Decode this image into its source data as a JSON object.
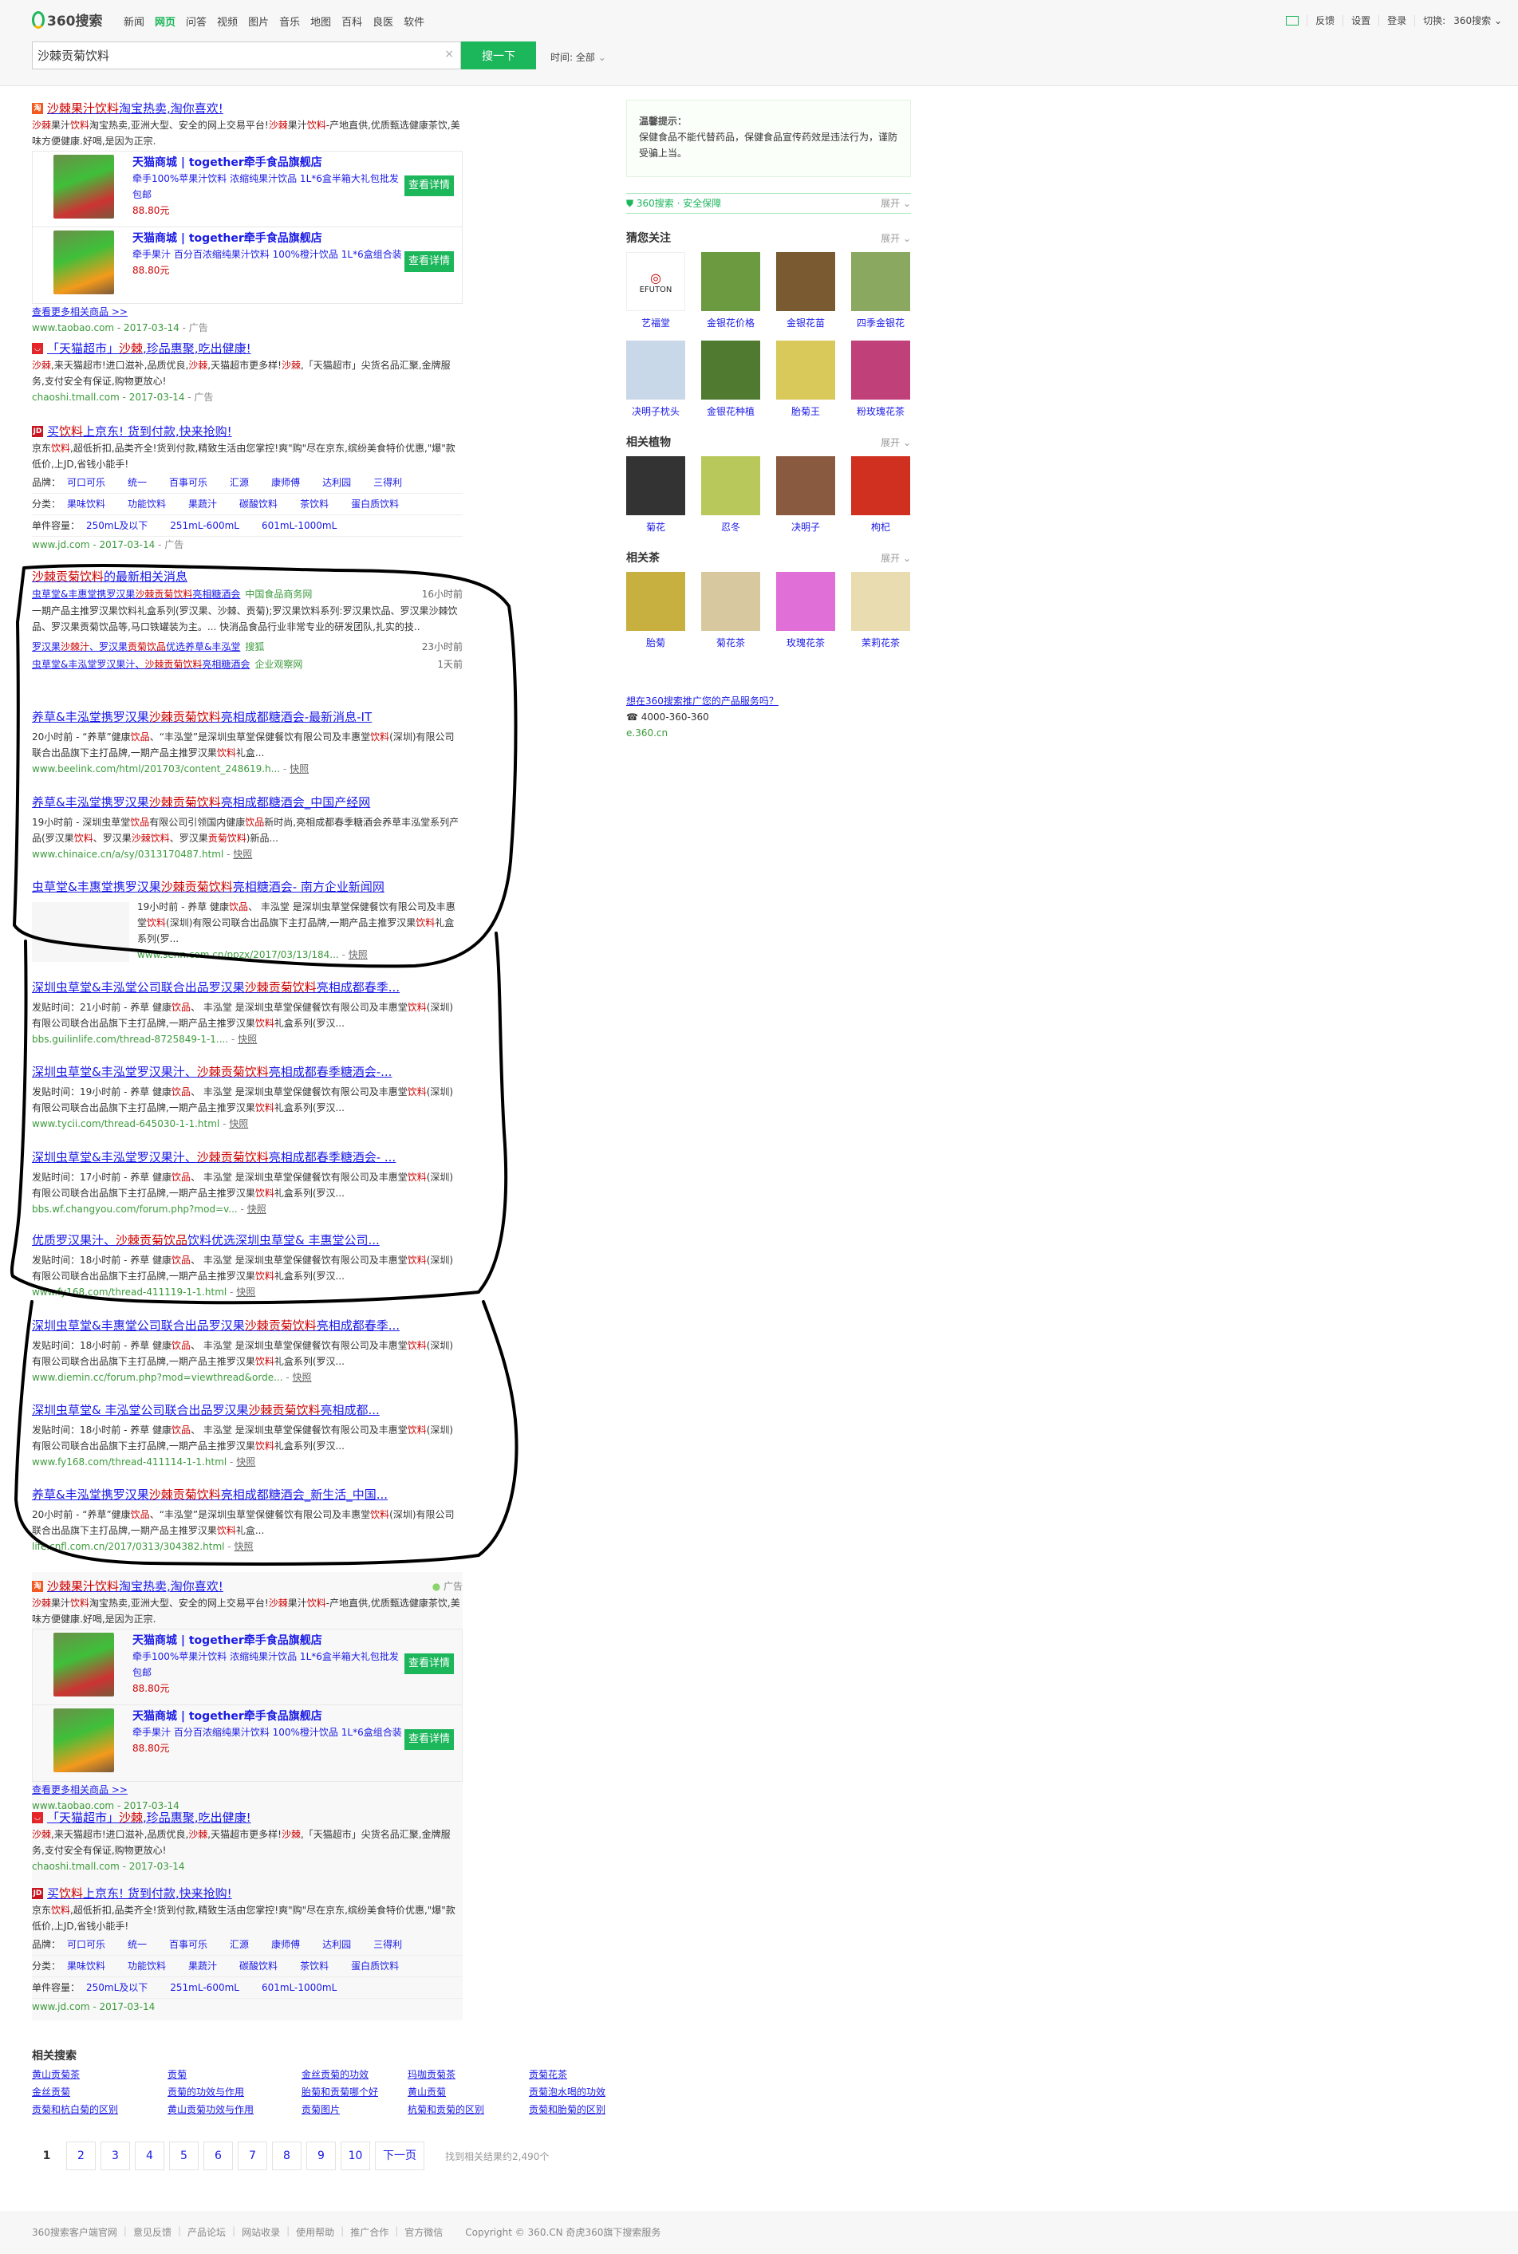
{
  "header": {
    "logo": "360搜索",
    "nav": [
      "新闻",
      "网页",
      "问答",
      "视频",
      "图片",
      "音乐",
      "地图",
      "百科",
      "良医",
      "软件"
    ],
    "nav_active": 1,
    "right_links": [
      "反馈",
      "设置",
      "登录"
    ],
    "switch_label": "切换:",
    "switch_value": "360搜索",
    "search_value": "沙棘贡菊饮料",
    "clear": "×",
    "search_button": "搜一下",
    "time_filter": "时间: 全部"
  },
  "colors": {
    "brand": "#1cb65b",
    "link": "#1a1ae6",
    "highlight": "#cc0000",
    "url": "#3c9a3c"
  },
  "ads_top": {
    "taobao": {
      "title": [
        [
          "沙棘果汁饮料",
          1
        ],
        [
          "淘宝热卖,淘你喜欢!",
          0
        ]
      ],
      "desc": [
        [
          "沙棘",
          1
        ],
        [
          "果汁",
          0
        ],
        [
          "饮料",
          1
        ],
        [
          "淘宝热卖,亚洲大型、安全的网上交易平台!",
          0
        ],
        [
          "沙棘",
          1
        ],
        [
          "果汁",
          0
        ],
        [
          "饮料",
          1
        ],
        [
          "-产地直供,优质甄选健康茶饮,美味方便健康.好喝,是因为正宗.",
          0
        ]
      ],
      "products": [
        {
          "name": "天猫商城 | together牵手食品旗舰店",
          "desc": "牵手100%苹果汁饮料 浓缩纯果汁饮品 1L*6盒半箱大礼包批发包邮",
          "price": "88.80元",
          "button": "查看详情"
        },
        {
          "name": "天猫商城 | together牵手食品旗舰店",
          "desc": "牵手果汁 百分百浓缩纯果汁饮料 100%橙汁饮品 1L*6盒组合装",
          "price": "88.80元",
          "button": "查看详情"
        }
      ],
      "more": "查看更多相关商品 >>",
      "url": "www.taobao.com - 2017-03-14",
      "ad_label": " - 广告"
    },
    "tmall": {
      "title": [
        [
          "「天猫超市」",
          0
        ],
        [
          "沙棘",
          1
        ],
        [
          ",珍品惠聚,吃出健康!",
          0
        ]
      ],
      "desc": [
        [
          "沙棘",
          1
        ],
        [
          ",来天猫超市!进口滋补,品质优良,",
          0
        ],
        [
          "沙棘",
          1
        ],
        [
          ",天猫超市更多样!",
          0
        ],
        [
          "沙棘",
          1
        ],
        [
          ",「天猫超市」尖货名品汇聚,金牌服务,支付安全有保证,购物更放心!",
          0
        ]
      ],
      "url": "chaoshi.tmall.com - 2017-03-14",
      "ad_label": " - 广告"
    },
    "jd": {
      "title": [
        [
          "买",
          0
        ],
        [
          "饮料",
          1
        ],
        [
          "上京东! 货到付款,快来抢购!",
          0
        ]
      ],
      "desc": [
        [
          "京东",
          0
        ],
        [
          "饮料",
          1
        ],
        [
          ",超低折扣,品类齐全!货到付款,精致生活由您掌控!爽\"购\"尽在京东,缤纷美食特价优惠,\"爆\"款低价,上JD,省钱小能手!",
          0
        ]
      ],
      "brand_label": "品牌：",
      "brands": [
        "可口可乐",
        "统一",
        "百事可乐",
        "汇源",
        "康师傅",
        "达利园",
        "三得利"
      ],
      "category_label": "分类：",
      "categories": [
        "果味饮料",
        "功能饮料",
        "果蔬汁",
        "碳酸饮料",
        "茶饮料",
        "蛋白质饮料"
      ],
      "volume_label": "单件容量：",
      "volumes": [
        "250mL及以下",
        "251mL-600mL",
        "601mL-1000mL"
      ],
      "url": "www.jd.com - 2017-03-14",
      "ad_label": " - 广告"
    }
  },
  "news": {
    "header": [
      [
        "沙棘贡菊饮料",
        1
      ],
      [
        "的最新相关消息",
        0
      ]
    ],
    "items": [
      {
        "title": [
          [
            "虫草堂&丰惠堂携罗汉果",
            0
          ],
          [
            "沙棘贡菊饮料",
            1
          ],
          [
            "亮相糖酒会",
            0
          ]
        ],
        "source": "中国食品商务网",
        "time": "16小时前",
        "snippet": "一期产品主推罗汉果饮料礼盒系列(罗汉果、沙棘、贡菊);罗汉果饮料系列:罗汉果饮品、罗汉果沙棘饮品、罗汉果贡菊饮品等,马口铁罐装为主。... 快消品食品行业非常专业的研发团队,扎实的技.."
      },
      {
        "title": [
          [
            "罗汉果",
            0
          ],
          [
            "沙棘汁",
            1
          ],
          [
            "、罗汉果",
            0
          ],
          [
            "贡菊饮品",
            1
          ],
          [
            "优选养草&丰泓堂",
            0
          ]
        ],
        "source": "搜狐",
        "time": "23小时前"
      },
      {
        "title": [
          [
            "虫草堂&丰泓堂罗汉果汁、",
            0
          ],
          [
            "沙棘贡菊饮料",
            1
          ],
          [
            "亮相糖酒会",
            0
          ]
        ],
        "source": "企业观察网",
        "time": "1天前"
      }
    ]
  },
  "results": [
    {
      "title": [
        [
          "养草&丰泓堂携罗汉果",
          0
        ],
        [
          "沙棘贡菊饮料",
          1
        ],
        [
          "亮相成都糖酒会-最新消息-IT",
          0
        ]
      ],
      "snippet": [
        [
          "20小时前 - “养草”健康",
          0
        ],
        [
          "饮品",
          1
        ],
        [
          "、“丰泓堂”是深圳虫草堂保健餐饮有限公司及丰惠堂",
          0
        ],
        [
          "饮料",
          1
        ],
        [
          "(深圳)有限公司联合出品旗下主打品牌,一期产品主推罗汉果",
          0
        ],
        [
          "饮料",
          1
        ],
        [
          "礼盒...",
          0
        ]
      ],
      "url": "www.beelink.com/html/201703/content_248619.h...",
      "snapshot": "快照"
    },
    {
      "title": [
        [
          "养草&丰泓堂携罗汉果",
          0
        ],
        [
          "沙棘贡菊饮料",
          1
        ],
        [
          "亮相成都糖酒会_中国产经网",
          0
        ]
      ],
      "snippet": [
        [
          "19小时前 - 深圳虫草堂",
          0
        ],
        [
          "饮品",
          1
        ],
        [
          "有限公司引领国内健康",
          0
        ],
        [
          "饮品",
          1
        ],
        [
          "新时尚,亮相成都春季糖酒会养草丰泓堂系列产品(罗汉果",
          0
        ],
        [
          "饮料",
          1
        ],
        [
          "、罗汉果",
          0
        ],
        [
          "沙棘饮料",
          1
        ],
        [
          "、罗汉果",
          0
        ],
        [
          "贡菊饮料",
          1
        ],
        [
          ")新品...",
          0
        ]
      ],
      "url": "www.chinaice.cn/a/sy/0313170487.html",
      "snapshot": "快照"
    },
    {
      "title": [
        [
          "虫草堂&丰惠堂携罗汉果",
          0
        ],
        [
          "沙棘贡菊饮料",
          1
        ],
        [
          "亮相糖酒会- 南方企业新闻网",
          0
        ]
      ],
      "has_thumb": true,
      "snippet": [
        [
          "19小时前 - 养草 健康",
          0
        ],
        [
          "饮品",
          1
        ],
        [
          "、 丰泓堂 是深圳虫草堂保健餐饮有限公司及丰惠堂",
          0
        ],
        [
          "饮料",
          1
        ],
        [
          "(深圳)有限公司联合出品旗下主打品牌,一期产品主推罗汉果",
          0
        ],
        [
          "饮料",
          1
        ],
        [
          "礼盒系列(罗...",
          0
        ]
      ],
      "url": "www.senn.com.cn/ppzx/2017/03/13/184...",
      "snapshot": "快照"
    },
    {
      "title": [
        [
          "深圳虫草堂&丰泓堂公司联合出品罗汉果",
          0
        ],
        [
          "沙棘贡菊饮料",
          1
        ],
        [
          "亮相成都春季...",
          0
        ]
      ],
      "snippet": [
        [
          "发贴时间：21小时前 - 养草 健康",
          0
        ],
        [
          "饮品",
          1
        ],
        [
          "、 丰泓堂 是深圳虫草堂保健餐饮有限公司及丰惠堂",
          0
        ],
        [
          "饮料",
          1
        ],
        [
          "(深圳)有限公司联合出品旗下主打品牌,一期产品主推罗汉果",
          0
        ],
        [
          "饮料",
          1
        ],
        [
          "礼盒系列(罗汉...",
          0
        ]
      ],
      "url": "bbs.guilinlife.com/thread-8725849-1-1....",
      "snapshot": "快照"
    },
    {
      "title": [
        [
          "深圳虫草堂&丰泓堂罗汉果汁、",
          0
        ],
        [
          "沙棘贡菊饮料",
          1
        ],
        [
          "亮相成都春季糖酒会-...",
          0
        ]
      ],
      "snippet": [
        [
          "发贴时间：19小时前 - 养草 健康",
          0
        ],
        [
          "饮品",
          1
        ],
        [
          "、 丰泓堂 是深圳虫草堂保健餐饮有限公司及丰惠堂",
          0
        ],
        [
          "饮料",
          1
        ],
        [
          "(深圳)有限公司联合出品旗下主打品牌,一期产品主推罗汉果",
          0
        ],
        [
          "饮料",
          1
        ],
        [
          "礼盒系列(罗汉...",
          0
        ]
      ],
      "url": "www.tycii.com/thread-645030-1-1.html",
      "snapshot": "快照"
    },
    {
      "title": [
        [
          "深圳虫草堂&丰泓堂罗汉果汁、",
          0
        ],
        [
          "沙棘贡菊饮料",
          1
        ],
        [
          "亮相成都春季糖酒会- ...",
          0
        ]
      ],
      "snippet": [
        [
          "发贴时间：17小时前 - 养草 健康",
          0
        ],
        [
          "饮品",
          1
        ],
        [
          "、 丰泓堂 是深圳虫草堂保健餐饮有限公司及丰惠堂",
          0
        ],
        [
          "饮料",
          1
        ],
        [
          "(深圳)有限公司联合出品旗下主打品牌,一期产品主推罗汉果",
          0
        ],
        [
          "饮料",
          1
        ],
        [
          "礼盒系列(罗汉...",
          0
        ]
      ],
      "url": "bbs.wf.changyou.com/forum.php?mod=v...",
      "snapshot": "快照"
    },
    {
      "title": [
        [
          "优质罗汉果汁、",
          0
        ],
        [
          "沙棘贡菊饮品",
          1
        ],
        [
          "饮料优选深圳虫草堂& 丰惠堂公司...",
          0
        ]
      ],
      "snippet": [
        [
          "发贴时间：18小时前 - 养草 健康",
          0
        ],
        [
          "饮品",
          1
        ],
        [
          "、 丰泓堂 是深圳虫草堂保健餐饮有限公司及丰惠堂",
          0
        ],
        [
          "饮料",
          1
        ],
        [
          "(深圳)有限公司联合出品旗下主打品牌,一期产品主推罗汉果",
          0
        ],
        [
          "饮料",
          1
        ],
        [
          "礼盒系列(罗汉...",
          0
        ]
      ],
      "url": "www.fy168.com/thread-411119-1-1.html",
      "snapshot": "快照"
    },
    {
      "title": [
        [
          "深圳虫草堂&丰惠堂公司联合出品罗汉果",
          0
        ],
        [
          "沙棘贡菊饮料",
          1
        ],
        [
          "亮相成都春季...",
          0
        ]
      ],
      "snippet": [
        [
          "发贴时间：18小时前 - 养草 健康",
          0
        ],
        [
          "饮品",
          1
        ],
        [
          "、 丰泓堂 是深圳虫草堂保健餐饮有限公司及丰惠堂",
          0
        ],
        [
          "饮料",
          1
        ],
        [
          "(深圳)有限公司联合出品旗下主打品牌,一期产品主推罗汉果",
          0
        ],
        [
          "饮料",
          1
        ],
        [
          "礼盒系列(罗汉...",
          0
        ]
      ],
      "url": "www.diemin.cc/forum.php?mod=viewthread&orde...",
      "snapshot": "快照"
    },
    {
      "title": [
        [
          "深圳虫草堂& 丰泓堂公司联合出品罗汉果",
          0
        ],
        [
          "沙棘贡菊饮料",
          1
        ],
        [
          "亮相成都...",
          0
        ]
      ],
      "snippet": [
        [
          "发贴时间：18小时前 - 养草 健康",
          0
        ],
        [
          "饮品",
          1
        ],
        [
          "、 丰泓堂 是深圳虫草堂保健餐饮有限公司及丰惠堂",
          0
        ],
        [
          "饮料",
          1
        ],
        [
          "(深圳)有限公司联合出品旗下主打品牌,一期产品主推罗汉果",
          0
        ],
        [
          "饮料",
          1
        ],
        [
          "礼盒系列(罗汉...",
          0
        ]
      ],
      "url": "www.fy168.com/thread-411114-1-1.html",
      "snapshot": "快照"
    },
    {
      "title": [
        [
          "养草&丰泓堂携罗汉果",
          0
        ],
        [
          "沙棘贡菊饮料",
          1
        ],
        [
          "亮相成都糖酒会_新生活_中国...",
          0
        ]
      ],
      "snippet": [
        [
          "20小时前 - “养草”健康",
          0
        ],
        [
          "饮品",
          1
        ],
        [
          "、“丰泓堂”是深圳虫草堂保健餐饮有限公司及丰惠堂",
          0
        ],
        [
          "饮料",
          1
        ],
        [
          "(深圳)有限公司联合出品旗下主打品牌,一期产品主推罗汉果",
          0
        ],
        [
          "饮料",
          1
        ],
        [
          "礼盒...",
          0
        ]
      ],
      "url": "life.cnfl.com.cn/2017/0313/304382.html",
      "snapshot": "快照"
    }
  ],
  "ads_bottom": {
    "ad_tag": "广告",
    "taobao": {
      "title": [
        [
          "沙棘果汁饮料",
          1
        ],
        [
          "淘宝热卖,淘你喜欢!",
          0
        ]
      ],
      "desc": [
        [
          "沙棘",
          1
        ],
        [
          "果汁",
          0
        ],
        [
          "饮料",
          1
        ],
        [
          "淘宝热卖,亚洲大型、安全的网上交易平台!",
          0
        ],
        [
          "沙棘",
          1
        ],
        [
          "果汁",
          0
        ],
        [
          "饮料",
          1
        ],
        [
          "-产地直供,优质甄选健康茶饮,美味方便健康.好喝,是因为正宗.",
          0
        ]
      ],
      "products": [
        {
          "name": "天猫商城 | together牵手食品旗舰店",
          "desc": "牵手100%苹果汁饮料 浓缩纯果汁饮品 1L*6盒半箱大礼包批发包邮",
          "price": "88.80元",
          "button": "查看详情"
        },
        {
          "name": "天猫商城 | together牵手食品旗舰店",
          "desc": "牵手果汁 百分百浓缩纯果汁饮料 100%橙汁饮品 1L*6盒组合装",
          "price": "88.80元",
          "button": "查看详情"
        }
      ],
      "more": "查看更多相关商品 >>",
      "url": "www.taobao.com - 2017-03-14"
    },
    "tmall": {
      "title": [
        [
          "「天猫超市」",
          0
        ],
        [
          "沙棘",
          1
        ],
        [
          ",珍品惠聚,吃出健康!",
          0
        ]
      ],
      "desc": [
        [
          "沙棘",
          1
        ],
        [
          ",来天猫超市!进口滋补,品质优良,",
          0
        ],
        [
          "沙棘",
          1
        ],
        [
          ",天猫超市更多样!",
          0
        ],
        [
          "沙棘",
          1
        ],
        [
          ",「天猫超市」尖货名品汇聚,金牌服务,支付安全有保证,购物更放心!",
          0
        ]
      ],
      "url": "chaoshi.tmall.com - 2017-03-14"
    },
    "jd": {
      "title": [
        [
          "买",
          0
        ],
        [
          "饮料",
          1
        ],
        [
          "上京东! 货到付款,快来抢购!",
          0
        ]
      ],
      "desc": [
        [
          "京东",
          0
        ],
        [
          "饮料",
          1
        ],
        [
          ",超低折扣,品类齐全!货到付款,精致生活由您掌控!爽\"购\"尽在京东,缤纷美食特价优惠,\"爆\"款低价,上JD,省钱小能手!",
          0
        ]
      ],
      "brand_label": "品牌：",
      "brands": [
        "可口可乐",
        "统一",
        "百事可乐",
        "汇源",
        "康师傅",
        "达利园",
        "三得利"
      ],
      "category_label": "分类：",
      "categories": [
        "果味饮料",
        "功能饮料",
        "果蔬汁",
        "碳酸饮料",
        "茶饮料",
        "蛋白质饮料"
      ],
      "volume_label": "单件容量：",
      "volumes": [
        "250mL及以下",
        "251mL-600mL",
        "601mL-1000mL"
      ],
      "url": "www.jd.com - 2017-03-14"
    }
  },
  "sidebar": {
    "tip_title": "温馨提示：",
    "tip_text": "保健食品不能代替药品，保健食品宣传药效是违法行为，谨防受骗上当。",
    "safe_label": "360搜索 · 安全保障",
    "expand": "展开",
    "sections": [
      {
        "title": "猜您关注",
        "items": [
          "艺福堂",
          "金银花价格",
          "金银花苗",
          "四季金银花",
          "决明子枕头",
          "金银花种植",
          "胎菊王",
          "粉玫瑰花茶"
        ]
      },
      {
        "title": "相关植物",
        "items": [
          "菊花",
          "忍冬",
          "决明子",
          "枸杞"
        ]
      },
      {
        "title": "相关茶",
        "items": [
          "胎菊",
          "菊花茶",
          "玫瑰花茶",
          "茉莉花茶"
        ]
      }
    ],
    "logo_text": "艺福堂 EFUTON",
    "promo_link": "想在360搜索推广您的产品服务吗？",
    "phone": "4000-360-360",
    "promo_url": "e.360.cn"
  },
  "related": {
    "title": "相关搜索",
    "items": [
      "黄山贡菊茶",
      "贡菊",
      "金丝贡菊的功效",
      "玛咖贡菊茶",
      "贡菊花茶",
      "金丝贡菊",
      "贡菊的功效与作用",
      "胎菊和贡菊哪个好",
      "黄山贡菊",
      "贡菊泡水喝的功效",
      "贡菊和杭白菊的区别",
      "黄山贡菊功效与作用",
      "贡菊图片",
      "杭菊和贡菊的区别",
      "贡菊和胎菊的区别"
    ]
  },
  "pagination": {
    "pages": [
      "1",
      "2",
      "3",
      "4",
      "5",
      "6",
      "7",
      "8",
      "9",
      "10"
    ],
    "current": "1",
    "next": "下一页",
    "count": "找到相关结果约2,490个"
  },
  "footer": {
    "links": [
      "360搜索客户端官网",
      "意见反馈",
      "产品论坛",
      "网站收录",
      "使用帮助",
      "推广合作",
      "官方微信"
    ],
    "copyright": "Copyright © 360.CN 奇虎360旗下搜索服务"
  }
}
